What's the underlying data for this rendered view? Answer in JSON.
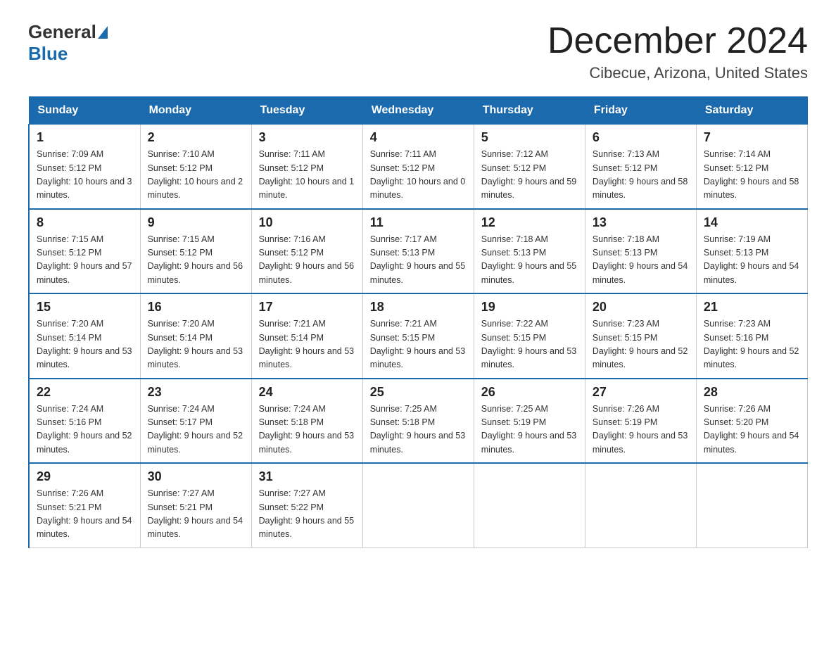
{
  "logo": {
    "general": "General",
    "blue": "Blue",
    "arrow_color": "#1a6aad"
  },
  "title": "December 2024",
  "subtitle": "Cibecue, Arizona, United States",
  "days_of_week": [
    "Sunday",
    "Monday",
    "Tuesday",
    "Wednesday",
    "Thursday",
    "Friday",
    "Saturday"
  ],
  "weeks": [
    [
      {
        "day": "1",
        "sunrise": "7:09 AM",
        "sunset": "5:12 PM",
        "daylight": "10 hours and 3 minutes."
      },
      {
        "day": "2",
        "sunrise": "7:10 AM",
        "sunset": "5:12 PM",
        "daylight": "10 hours and 2 minutes."
      },
      {
        "day": "3",
        "sunrise": "7:11 AM",
        "sunset": "5:12 PM",
        "daylight": "10 hours and 1 minute."
      },
      {
        "day": "4",
        "sunrise": "7:11 AM",
        "sunset": "5:12 PM",
        "daylight": "10 hours and 0 minutes."
      },
      {
        "day": "5",
        "sunrise": "7:12 AM",
        "sunset": "5:12 PM",
        "daylight": "9 hours and 59 minutes."
      },
      {
        "day": "6",
        "sunrise": "7:13 AM",
        "sunset": "5:12 PM",
        "daylight": "9 hours and 58 minutes."
      },
      {
        "day": "7",
        "sunrise": "7:14 AM",
        "sunset": "5:12 PM",
        "daylight": "9 hours and 58 minutes."
      }
    ],
    [
      {
        "day": "8",
        "sunrise": "7:15 AM",
        "sunset": "5:12 PM",
        "daylight": "9 hours and 57 minutes."
      },
      {
        "day": "9",
        "sunrise": "7:15 AM",
        "sunset": "5:12 PM",
        "daylight": "9 hours and 56 minutes."
      },
      {
        "day": "10",
        "sunrise": "7:16 AM",
        "sunset": "5:12 PM",
        "daylight": "9 hours and 56 minutes."
      },
      {
        "day": "11",
        "sunrise": "7:17 AM",
        "sunset": "5:13 PM",
        "daylight": "9 hours and 55 minutes."
      },
      {
        "day": "12",
        "sunrise": "7:18 AM",
        "sunset": "5:13 PM",
        "daylight": "9 hours and 55 minutes."
      },
      {
        "day": "13",
        "sunrise": "7:18 AM",
        "sunset": "5:13 PM",
        "daylight": "9 hours and 54 minutes."
      },
      {
        "day": "14",
        "sunrise": "7:19 AM",
        "sunset": "5:13 PM",
        "daylight": "9 hours and 54 minutes."
      }
    ],
    [
      {
        "day": "15",
        "sunrise": "7:20 AM",
        "sunset": "5:14 PM",
        "daylight": "9 hours and 53 minutes."
      },
      {
        "day": "16",
        "sunrise": "7:20 AM",
        "sunset": "5:14 PM",
        "daylight": "9 hours and 53 minutes."
      },
      {
        "day": "17",
        "sunrise": "7:21 AM",
        "sunset": "5:14 PM",
        "daylight": "9 hours and 53 minutes."
      },
      {
        "day": "18",
        "sunrise": "7:21 AM",
        "sunset": "5:15 PM",
        "daylight": "9 hours and 53 minutes."
      },
      {
        "day": "19",
        "sunrise": "7:22 AM",
        "sunset": "5:15 PM",
        "daylight": "9 hours and 53 minutes."
      },
      {
        "day": "20",
        "sunrise": "7:23 AM",
        "sunset": "5:15 PM",
        "daylight": "9 hours and 52 minutes."
      },
      {
        "day": "21",
        "sunrise": "7:23 AM",
        "sunset": "5:16 PM",
        "daylight": "9 hours and 52 minutes."
      }
    ],
    [
      {
        "day": "22",
        "sunrise": "7:24 AM",
        "sunset": "5:16 PM",
        "daylight": "9 hours and 52 minutes."
      },
      {
        "day": "23",
        "sunrise": "7:24 AM",
        "sunset": "5:17 PM",
        "daylight": "9 hours and 52 minutes."
      },
      {
        "day": "24",
        "sunrise": "7:24 AM",
        "sunset": "5:18 PM",
        "daylight": "9 hours and 53 minutes."
      },
      {
        "day": "25",
        "sunrise": "7:25 AM",
        "sunset": "5:18 PM",
        "daylight": "9 hours and 53 minutes."
      },
      {
        "day": "26",
        "sunrise": "7:25 AM",
        "sunset": "5:19 PM",
        "daylight": "9 hours and 53 minutes."
      },
      {
        "day": "27",
        "sunrise": "7:26 AM",
        "sunset": "5:19 PM",
        "daylight": "9 hours and 53 minutes."
      },
      {
        "day": "28",
        "sunrise": "7:26 AM",
        "sunset": "5:20 PM",
        "daylight": "9 hours and 54 minutes."
      }
    ],
    [
      {
        "day": "29",
        "sunrise": "7:26 AM",
        "sunset": "5:21 PM",
        "daylight": "9 hours and 54 minutes."
      },
      {
        "day": "30",
        "sunrise": "7:27 AM",
        "sunset": "5:21 PM",
        "daylight": "9 hours and 54 minutes."
      },
      {
        "day": "31",
        "sunrise": "7:27 AM",
        "sunset": "5:22 PM",
        "daylight": "9 hours and 55 minutes."
      },
      null,
      null,
      null,
      null
    ]
  ]
}
